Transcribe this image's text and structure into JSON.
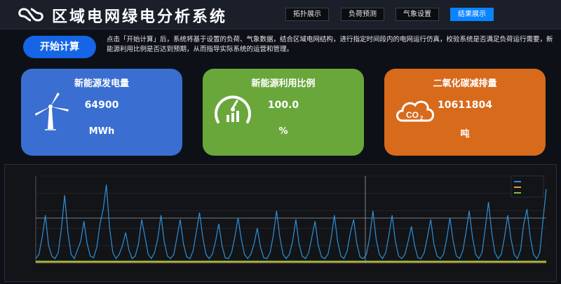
{
  "header": {
    "title": "区域电网绿电分析系统",
    "tabs": [
      {
        "label": "拓扑展示",
        "active": false
      },
      {
        "label": "负荷预测",
        "active": false
      },
      {
        "label": "气象设置",
        "active": false
      },
      {
        "label": "结果展示",
        "active": true
      }
    ]
  },
  "action": {
    "start_label": "开始计算",
    "description": "点击「开始计算」后，系统将基于设置的负荷、气象数据，结合区域电网结构，进行指定时间段内的电网运行仿真，校验系统是否满足负荷运行需要，新能源利用比例是否达到预期，从而指导实际系统的运营和管理。"
  },
  "cards": [
    {
      "title": "新能源发电量",
      "value": "64900",
      "unit": "MWh",
      "icon": "wind-turbine-icon",
      "color": "#3a6fd1"
    },
    {
      "title": "新能源利用比例",
      "value": "100.0",
      "unit": "%",
      "icon": "gauge-icon",
      "color": "#6aa73b"
    },
    {
      "title": "二氧化碳减排量",
      "value": "10611804",
      "unit": "吨",
      "icon": "co2-cloud-icon",
      "color": "#d86a1c"
    }
  ],
  "chart_data": {
    "type": "line",
    "x": [
      0,
      1,
      2,
      3,
      4,
      5,
      6,
      7,
      8,
      9,
      10,
      11,
      12,
      13,
      14,
      15,
      16,
      17,
      18,
      19,
      20,
      21,
      22,
      23,
      24,
      25,
      26,
      27,
      28,
      29,
      30,
      31,
      32,
      33,
      34,
      35,
      36,
      37,
      38,
      39,
      40,
      41,
      42,
      43,
      44,
      45,
      46,
      47,
      48,
      49,
      50,
      51,
      52,
      53,
      54,
      55,
      56,
      57,
      58,
      59,
      60,
      61,
      62,
      63,
      64,
      65,
      66,
      67,
      68,
      69,
      70,
      71,
      72,
      73,
      74,
      75,
      76,
      77,
      78,
      79,
      80,
      81,
      82,
      83,
      84,
      85,
      86,
      87,
      88,
      89,
      90,
      91,
      92,
      93,
      94,
      95,
      96,
      97,
      98,
      99,
      100,
      101,
      102,
      103,
      104,
      105,
      106,
      107,
      108,
      109,
      110,
      111,
      112,
      113,
      114,
      115,
      116,
      117,
      118,
      119,
      120,
      121,
      122,
      123,
      124,
      125,
      126,
      127,
      128,
      129,
      130,
      131,
      132,
      133,
      134,
      135,
      136,
      137,
      138,
      139,
      140,
      141,
      142,
      143,
      144,
      145,
      146,
      147,
      148,
      149,
      150,
      151,
      152,
      153,
      154,
      155,
      156,
      157,
      158,
      159
    ],
    "series": [
      {
        "color": "#2f8fd8",
        "values": [
          0.05,
          0.1,
          0.3,
          0.55,
          0.2,
          0.08,
          0.05,
          0.12,
          0.4,
          0.78,
          0.35,
          0.1,
          0.05,
          0.15,
          0.25,
          0.48,
          0.22,
          0.08,
          0.06,
          0.18,
          0.45,
          0.62,
          0.9,
          0.4,
          0.12,
          0.05,
          0.1,
          0.2,
          0.35,
          0.15,
          0.05,
          0.08,
          0.22,
          0.5,
          0.3,
          0.1,
          0.05,
          0.12,
          0.28,
          0.55,
          0.25,
          0.08,
          0.05,
          0.1,
          0.3,
          0.5,
          0.22,
          0.07,
          0.05,
          0.14,
          0.35,
          0.58,
          0.3,
          0.1,
          0.05,
          0.1,
          0.25,
          0.45,
          0.2,
          0.06,
          0.05,
          0.12,
          0.3,
          0.52,
          0.28,
          0.1,
          0.05,
          0.1,
          0.22,
          0.4,
          0.18,
          0.06,
          0.05,
          0.12,
          0.32,
          0.6,
          0.3,
          0.1,
          0.05,
          0.1,
          0.25,
          0.5,
          0.22,
          0.08,
          0.05,
          0.12,
          0.3,
          0.48,
          0.2,
          0.07,
          0.05,
          0.1,
          0.28,
          0.55,
          0.25,
          0.08,
          0.05,
          0.14,
          0.35,
          0.5,
          0.22,
          0.07,
          0.05,
          0.1,
          0.3,
          0.6,
          0.28,
          0.1,
          0.05,
          0.12,
          0.32,
          0.55,
          0.25,
          0.08,
          0.05,
          0.1,
          0.25,
          0.42,
          0.2,
          0.06,
          0.05,
          0.12,
          0.3,
          0.5,
          0.22,
          0.08,
          0.05,
          0.1,
          0.28,
          0.52,
          0.25,
          0.08,
          0.05,
          0.14,
          0.35,
          0.6,
          0.3,
          0.1,
          0.05,
          0.12,
          0.4,
          0.7,
          0.35,
          0.12,
          0.05,
          0.1,
          0.3,
          0.55,
          0.28,
          0.1,
          0.05,
          0.15,
          0.45,
          0.62,
          0.3,
          0.1,
          0.05,
          0.12,
          0.5,
          0.85,
          0.6,
          0.3
        ]
      },
      {
        "color": "#e0a030",
        "values": [
          0.01,
          0.01,
          0.01,
          0.01,
          0.01,
          0.01,
          0.01,
          0.01,
          0.01,
          0.01,
          0.01,
          0.01,
          0.01,
          0.01,
          0.01,
          0.01,
          0.01,
          0.01,
          0.01,
          0.01,
          0.01,
          0.01,
          0.01,
          0.01,
          0.01,
          0.01,
          0.01,
          0.01,
          0.01,
          0.01,
          0.01,
          0.01,
          0.01,
          0.01,
          0.01,
          0.01,
          0.01,
          0.01,
          0.01,
          0.01,
          0.01,
          0.01,
          0.01,
          0.01,
          0.01,
          0.01,
          0.01,
          0.01,
          0.01,
          0.01,
          0.01,
          0.01,
          0.01,
          0.01,
          0.01,
          0.01,
          0.01,
          0.01,
          0.01,
          0.01,
          0.01,
          0.01,
          0.01,
          0.01,
          0.01,
          0.01,
          0.01,
          0.01,
          0.01,
          0.01,
          0.01,
          0.01,
          0.01,
          0.01,
          0.01,
          0.01,
          0.01,
          0.01,
          0.01,
          0.01,
          0.01,
          0.01,
          0.01,
          0.01,
          0.01,
          0.01,
          0.01,
          0.01,
          0.01,
          0.01,
          0.01,
          0.01,
          0.01,
          0.01,
          0.01,
          0.01,
          0.01,
          0.01,
          0.01,
          0.01,
          0.01,
          0.01,
          0.01,
          0.01,
          0.01,
          0.01,
          0.01,
          0.01,
          0.01,
          0.01,
          0.01,
          0.01,
          0.01,
          0.01,
          0.01,
          0.01,
          0.01,
          0.01,
          0.01,
          0.01,
          0.01,
          0.01,
          0.01,
          0.01,
          0.01,
          0.01,
          0.01,
          0.01,
          0.01,
          0.01,
          0.01,
          0.01,
          0.01,
          0.01,
          0.01,
          0.01,
          0.01,
          0.01,
          0.01,
          0.01,
          0.01,
          0.01,
          0.01,
          0.01,
          0.01,
          0.01,
          0.01,
          0.01,
          0.01,
          0.01,
          0.01,
          0.01,
          0.01,
          0.01,
          0.01,
          0.01,
          0.01,
          0.01,
          0.01,
          0.01,
          0.01,
          0.01
        ]
      },
      {
        "color": "#7ac23c",
        "values": [
          0.02,
          0.02,
          0.02,
          0.02,
          0.02,
          0.02,
          0.02,
          0.02,
          0.02,
          0.02,
          0.02,
          0.02,
          0.02,
          0.02,
          0.02,
          0.02,
          0.02,
          0.02,
          0.02,
          0.02,
          0.02,
          0.02,
          0.02,
          0.02,
          0.02,
          0.02,
          0.02,
          0.02,
          0.02,
          0.02,
          0.02,
          0.02,
          0.02,
          0.02,
          0.02,
          0.02,
          0.02,
          0.02,
          0.02,
          0.02,
          0.02,
          0.02,
          0.02,
          0.02,
          0.02,
          0.02,
          0.02,
          0.02,
          0.02,
          0.02,
          0.02,
          0.02,
          0.02,
          0.02,
          0.02,
          0.02,
          0.02,
          0.02,
          0.02,
          0.02,
          0.02,
          0.02,
          0.02,
          0.02,
          0.02,
          0.02,
          0.02,
          0.02,
          0.02,
          0.02,
          0.02,
          0.02,
          0.02,
          0.02,
          0.02,
          0.02,
          0.02,
          0.02,
          0.02,
          0.02,
          0.02,
          0.02,
          0.02,
          0.02,
          0.02,
          0.02,
          0.02,
          0.02,
          0.02,
          0.02,
          0.02,
          0.02,
          0.02,
          0.02,
          0.02,
          0.02,
          0.02,
          0.02,
          0.02,
          0.02,
          0.02,
          0.02,
          0.02,
          0.02,
          0.02,
          0.02,
          0.02,
          0.02,
          0.02,
          0.02,
          0.02,
          0.02,
          0.02,
          0.02,
          0.02,
          0.02,
          0.02,
          0.02,
          0.02,
          0.02,
          0.02,
          0.02,
          0.02,
          0.02,
          0.02,
          0.02,
          0.02,
          0.02,
          0.02,
          0.02,
          0.02,
          0.02,
          0.02,
          0.02,
          0.02,
          0.02,
          0.02,
          0.02,
          0.02,
          0.02,
          0.02,
          0.02,
          0.02,
          0.02,
          0.02,
          0.02,
          0.02,
          0.02,
          0.02,
          0.02,
          0.02,
          0.02,
          0.02,
          0.02,
          0.02,
          0.02,
          0.02,
          0.02,
          0.02,
          0.02,
          0.02,
          0.02
        ]
      }
    ],
    "ylim": [
      0,
      1
    ],
    "grid": true
  }
}
